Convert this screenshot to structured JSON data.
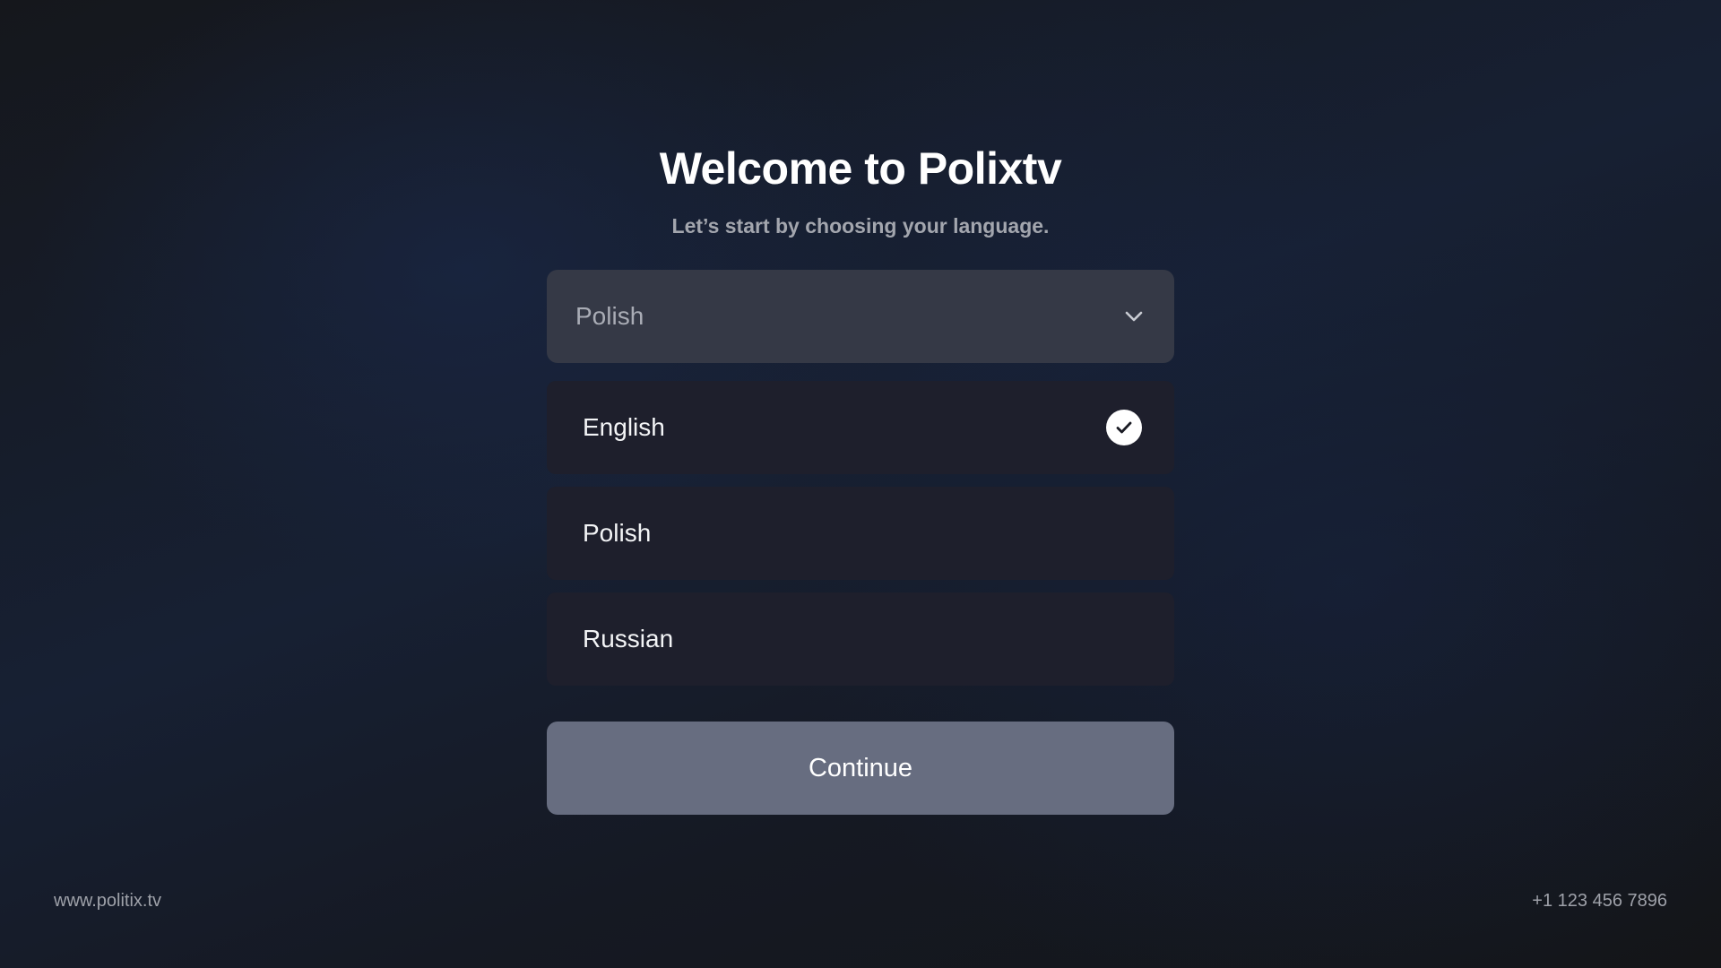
{
  "header": {
    "title": "Welcome to Polixtv",
    "subtitle": "Let’s start by choosing your language."
  },
  "language_select": {
    "value": "Polish",
    "icon": "chevron-down-icon"
  },
  "language_options": [
    {
      "label": "English",
      "selected": true
    },
    {
      "label": "Polish",
      "selected": false
    },
    {
      "label": "Russian",
      "selected": false
    }
  ],
  "continue_button": {
    "label": "Continue"
  },
  "footer": {
    "website": "www.politix.tv",
    "phone": "+1 123 456 7896"
  },
  "colors": {
    "background": "#141518",
    "select_bg": "#353946",
    "option_bg": "#1e1f2c",
    "button_bg": "#676d80",
    "text_primary": "#ffffff",
    "text_secondary": "#a3a6ae"
  }
}
